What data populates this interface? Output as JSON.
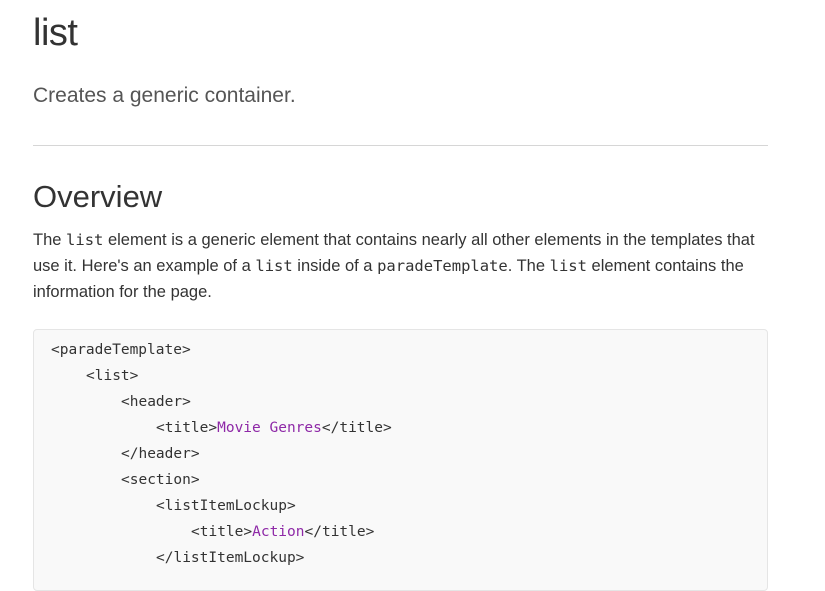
{
  "page": {
    "title": "list",
    "abstract": "Creates a generic container."
  },
  "overview": {
    "heading": "Overview",
    "paragraph": [
      {
        "text": "The ",
        "code": false
      },
      {
        "text": "list",
        "code": true
      },
      {
        "text": " element is a generic element that contains nearly all other elements in the templates that use it. Here's an example of a ",
        "code": false
      },
      {
        "text": "list",
        "code": true
      },
      {
        "text": " inside of a ",
        "code": false
      },
      {
        "text": "paradeTemplate",
        "code": true
      },
      {
        "text": ". The ",
        "code": false
      },
      {
        "text": "list",
        "code": true
      },
      {
        "text": " element contains the information for the page.",
        "code": false
      }
    ]
  },
  "code_example": {
    "colors": {
      "text": "#333333",
      "string": "#8e29a7",
      "background": "#f9f9f9"
    },
    "lines": [
      {
        "indent": 0,
        "before": "<paradeTemplate>",
        "content": "",
        "after": ""
      },
      {
        "indent": 1,
        "before": "<list>",
        "content": "",
        "after": ""
      },
      {
        "indent": 2,
        "before": "<header>",
        "content": "",
        "after": ""
      },
      {
        "indent": 3,
        "before": "<title>",
        "content": "Movie Genres",
        "after": "</title>"
      },
      {
        "indent": 2,
        "before": "</header>",
        "content": "",
        "after": ""
      },
      {
        "indent": 2,
        "before": "<section>",
        "content": "",
        "after": ""
      },
      {
        "indent": 3,
        "before": "<listItemLockup>",
        "content": "",
        "after": ""
      },
      {
        "indent": 4,
        "before": "<title>",
        "content": "Action",
        "after": "</title>"
      },
      {
        "indent": 3,
        "before": "</listItemLockup>",
        "content": "",
        "after": ""
      }
    ]
  }
}
